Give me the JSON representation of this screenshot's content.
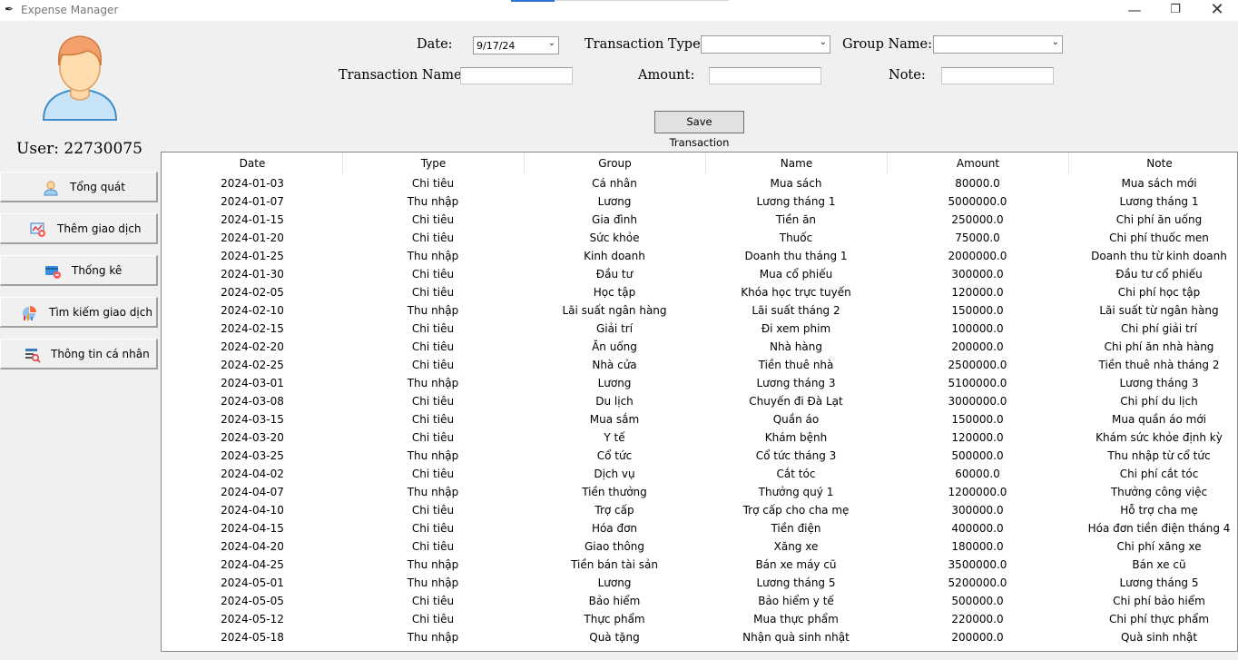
{
  "window": {
    "title": "Expense Manager",
    "buttons": {
      "minimize": "—",
      "maximize": "❐",
      "close": "✕"
    }
  },
  "user": {
    "label": "User: 22730075"
  },
  "nav": [
    {
      "label": "Tổng quát",
      "icon": "user-icon"
    },
    {
      "label": "Thêm giao dịch",
      "icon": "add-transaction-icon"
    },
    {
      "label": "Thống kê",
      "icon": "card-stats-icon"
    },
    {
      "label": "Tìm kiếm giao dịch",
      "icon": "chart-search-icon"
    },
    {
      "label": "Thông tin cá nhân",
      "icon": "profile-info-icon"
    }
  ],
  "form": {
    "date_label": "Date:",
    "date_value": "9/17/24",
    "type_label": "Transaction Type:",
    "type_value": "",
    "group_label": "Group Name:",
    "group_value": "",
    "name_label": "Transaction Name:",
    "name_value": "",
    "amount_label": "Amount:",
    "amount_value": "",
    "note_label": "Note:",
    "note_value": "",
    "save_label": "Save Transaction"
  },
  "table": {
    "columns": [
      "Date",
      "Type",
      "Group",
      "Name",
      "Amount",
      "Note"
    ],
    "rows": [
      [
        "2024-01-03",
        "Chi tiêu",
        "Cá nhân",
        "Mua sách",
        "80000.0",
        "Mua sách mới"
      ],
      [
        "2024-01-07",
        "Thu nhập",
        "Lương",
        "Lương tháng 1",
        "5000000.0",
        "Lương tháng 1"
      ],
      [
        "2024-01-15",
        "Chi tiêu",
        "Gia đình",
        "Tiền ăn",
        "250000.0",
        "Chi phí ăn uống"
      ],
      [
        "2024-01-20",
        "Chi tiêu",
        "Sức khỏe",
        "Thuốc",
        "75000.0",
        "Chi phí thuốc men"
      ],
      [
        "2024-01-25",
        "Thu nhập",
        "Kinh doanh",
        "Doanh thu tháng 1",
        "2000000.0",
        "Doanh thu từ kinh doanh"
      ],
      [
        "2024-01-30",
        "Chi tiêu",
        "Đầu tư",
        "Mua cổ phiếu",
        "300000.0",
        "Đầu tư cổ phiếu"
      ],
      [
        "2024-02-05",
        "Chi tiêu",
        "Học tập",
        "Khóa học trực tuyến",
        "120000.0",
        "Chi phí học tập"
      ],
      [
        "2024-02-10",
        "Thu nhập",
        "Lãi suất ngân hàng",
        "Lãi suất tháng 2",
        "150000.0",
        "Lãi suất từ ngân hàng"
      ],
      [
        "2024-02-15",
        "Chi tiêu",
        "Giải trí",
        "Đi xem phim",
        "100000.0",
        "Chi phí giải trí"
      ],
      [
        "2024-02-20",
        "Chi tiêu",
        "Ăn uống",
        "Nhà hàng",
        "200000.0",
        "Chi phí ăn nhà hàng"
      ],
      [
        "2024-02-25",
        "Chi tiêu",
        "Nhà cửa",
        "Tiền thuê nhà",
        "2500000.0",
        "Tiền thuê nhà tháng 2"
      ],
      [
        "2024-03-01",
        "Thu nhập",
        "Lương",
        "Lương tháng 3",
        "5100000.0",
        "Lương tháng 3"
      ],
      [
        "2024-03-08",
        "Chi tiêu",
        "Du lịch",
        "Chuyến đi Đà Lạt",
        "3000000.0",
        "Chi phí du lịch"
      ],
      [
        "2024-03-15",
        "Chi tiêu",
        "Mua sắm",
        "Quần áo",
        "150000.0",
        "Mua quần áo mới"
      ],
      [
        "2024-03-20",
        "Chi tiêu",
        "Y tế",
        "Khám bệnh",
        "120000.0",
        "Khám sức khỏe định kỳ"
      ],
      [
        "2024-03-25",
        "Thu nhập",
        "Cổ tức",
        "Cổ tức tháng 3",
        "500000.0",
        "Thu nhập từ cổ tức"
      ],
      [
        "2024-04-02",
        "Chi tiêu",
        "Dịch vụ",
        "Cắt tóc",
        "60000.0",
        "Chi phí cắt tóc"
      ],
      [
        "2024-04-07",
        "Thu nhập",
        "Tiền thưởng",
        "Thưởng quý 1",
        "1200000.0",
        "Thưởng công việc"
      ],
      [
        "2024-04-10",
        "Chi tiêu",
        "Trợ cấp",
        "Trợ cấp cho cha mẹ",
        "300000.0",
        "Hỗ trợ cha mẹ"
      ],
      [
        "2024-04-15",
        "Chi tiêu",
        "Hóa đơn",
        "Tiền điện",
        "400000.0",
        "Hóa đơn tiền điện tháng 4"
      ],
      [
        "2024-04-20",
        "Chi tiêu",
        "Giao thông",
        "Xăng xe",
        "180000.0",
        "Chi phí xăng xe"
      ],
      [
        "2024-04-25",
        "Thu nhập",
        "Tiền bán tài sản",
        "Bán xe máy cũ",
        "3500000.0",
        "Bán xe cũ"
      ],
      [
        "2024-05-01",
        "Thu nhập",
        "Lương",
        "Lương tháng 5",
        "5200000.0",
        "Lương tháng 5"
      ],
      [
        "2024-05-05",
        "Chi tiêu",
        "Bảo hiểm",
        "Bảo hiểm y tế",
        "500000.0",
        "Chi phí bảo hiểm"
      ],
      [
        "2024-05-12",
        "Chi tiêu",
        "Thực phẩm",
        "Mua thực phẩm",
        "220000.0",
        "Chi phí thực phẩm"
      ],
      [
        "2024-05-18",
        "Thu nhập",
        "Quà tặng",
        "Nhận quà sinh nhật",
        "200000.0",
        "Quà sinh nhật"
      ]
    ]
  }
}
